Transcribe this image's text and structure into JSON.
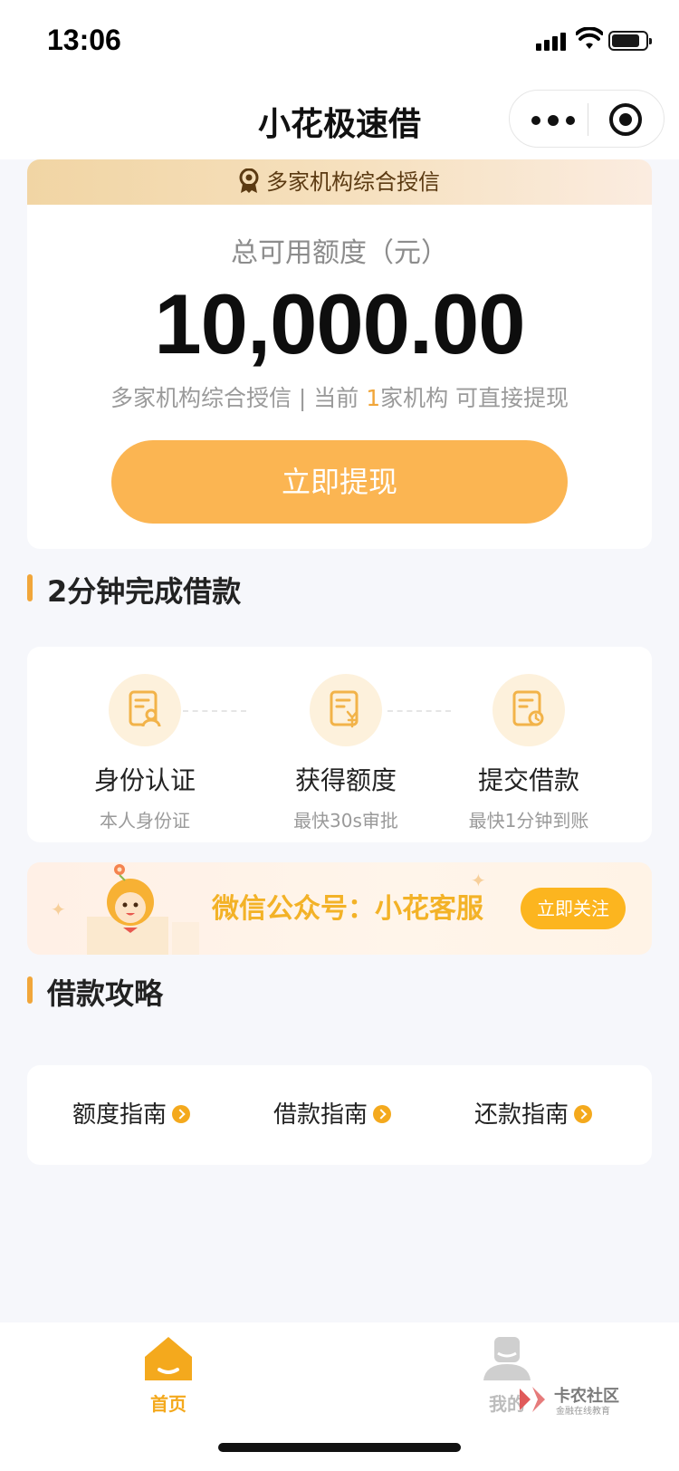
{
  "status_bar": {
    "time": "13:06"
  },
  "nav": {
    "title": "小花极速借"
  },
  "credit": {
    "banner": "多家机构综合授信",
    "label": "总可用额度（元）",
    "amount": "10,000.00",
    "sub_prefix": "多家机构综合授信 | 当前 ",
    "sub_highlight": "1",
    "sub_suffix": "家机构 可直接提现",
    "withdraw_label": "立即提现"
  },
  "steps_section": {
    "title": "2分钟完成借款",
    "steps": [
      {
        "icon": "id-document-icon",
        "title": "身份认证",
        "sub": "本人身份证"
      },
      {
        "icon": "yuan-document-icon",
        "title": "获得额度",
        "sub": "最快30s审批"
      },
      {
        "icon": "clock-document-icon",
        "title": "提交借款",
        "sub": "最快1分钟到账"
      }
    ]
  },
  "wechat": {
    "text": "微信公众号：小花客服",
    "follow_label": "立即关注"
  },
  "guide_section": {
    "title": "借款攻略",
    "items": [
      "额度指南",
      "借款指南",
      "还款指南"
    ]
  },
  "tabs": [
    {
      "icon": "home-icon",
      "label": "首页",
      "active": true
    },
    {
      "icon": "user-icon",
      "label": "我的",
      "active": false
    }
  ],
  "watermark": {
    "main": "卡农社区",
    "sub": "金融在线教育"
  },
  "colors": {
    "accent": "#f4a91d",
    "button": "#fbb552",
    "banner_text": "#5b3a12"
  }
}
